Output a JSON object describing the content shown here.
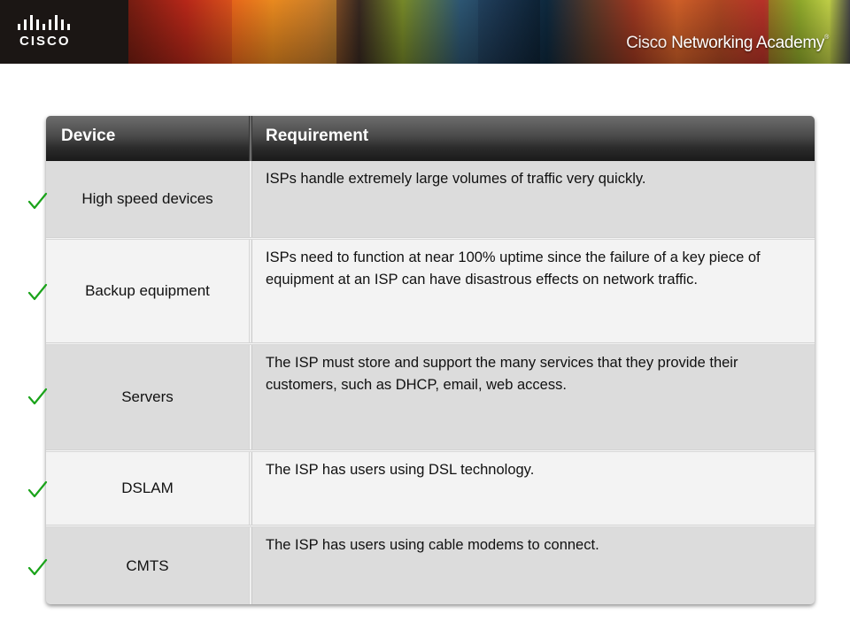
{
  "banner": {
    "logo_text": "CISCO",
    "academy_prefix": "Cisco",
    "academy_main": "Networking Academy",
    "trademark": "®"
  },
  "colors": {
    "check": "#1aa31a",
    "header_dark": "#1a1a1a",
    "row_shaded": "#dcdcdc",
    "row_light": "#f3f3f3"
  },
  "table": {
    "headers": {
      "device": "Device",
      "requirement": "Requirement"
    },
    "rows": [
      {
        "device": "High speed devices",
        "requirement": "ISPs handle extremely large volumes of traffic very quickly.",
        "checked": true
      },
      {
        "device": "Backup equipment",
        "requirement": "ISPs need to function at near 100% uptime since the failure of a key piece of equipment at an ISP can have disastrous effects on network traffic.",
        "checked": true
      },
      {
        "device": "Servers",
        "requirement": "The ISP must store and support the many services that they provide their customers, such as DHCP, email, web access.",
        "checked": true
      },
      {
        "device": "DSLAM",
        "requirement": "The ISP has users using DSL technology.",
        "checked": true
      },
      {
        "device": "CMTS",
        "requirement": "The ISP has users using cable modems to connect.",
        "checked": true
      }
    ]
  }
}
